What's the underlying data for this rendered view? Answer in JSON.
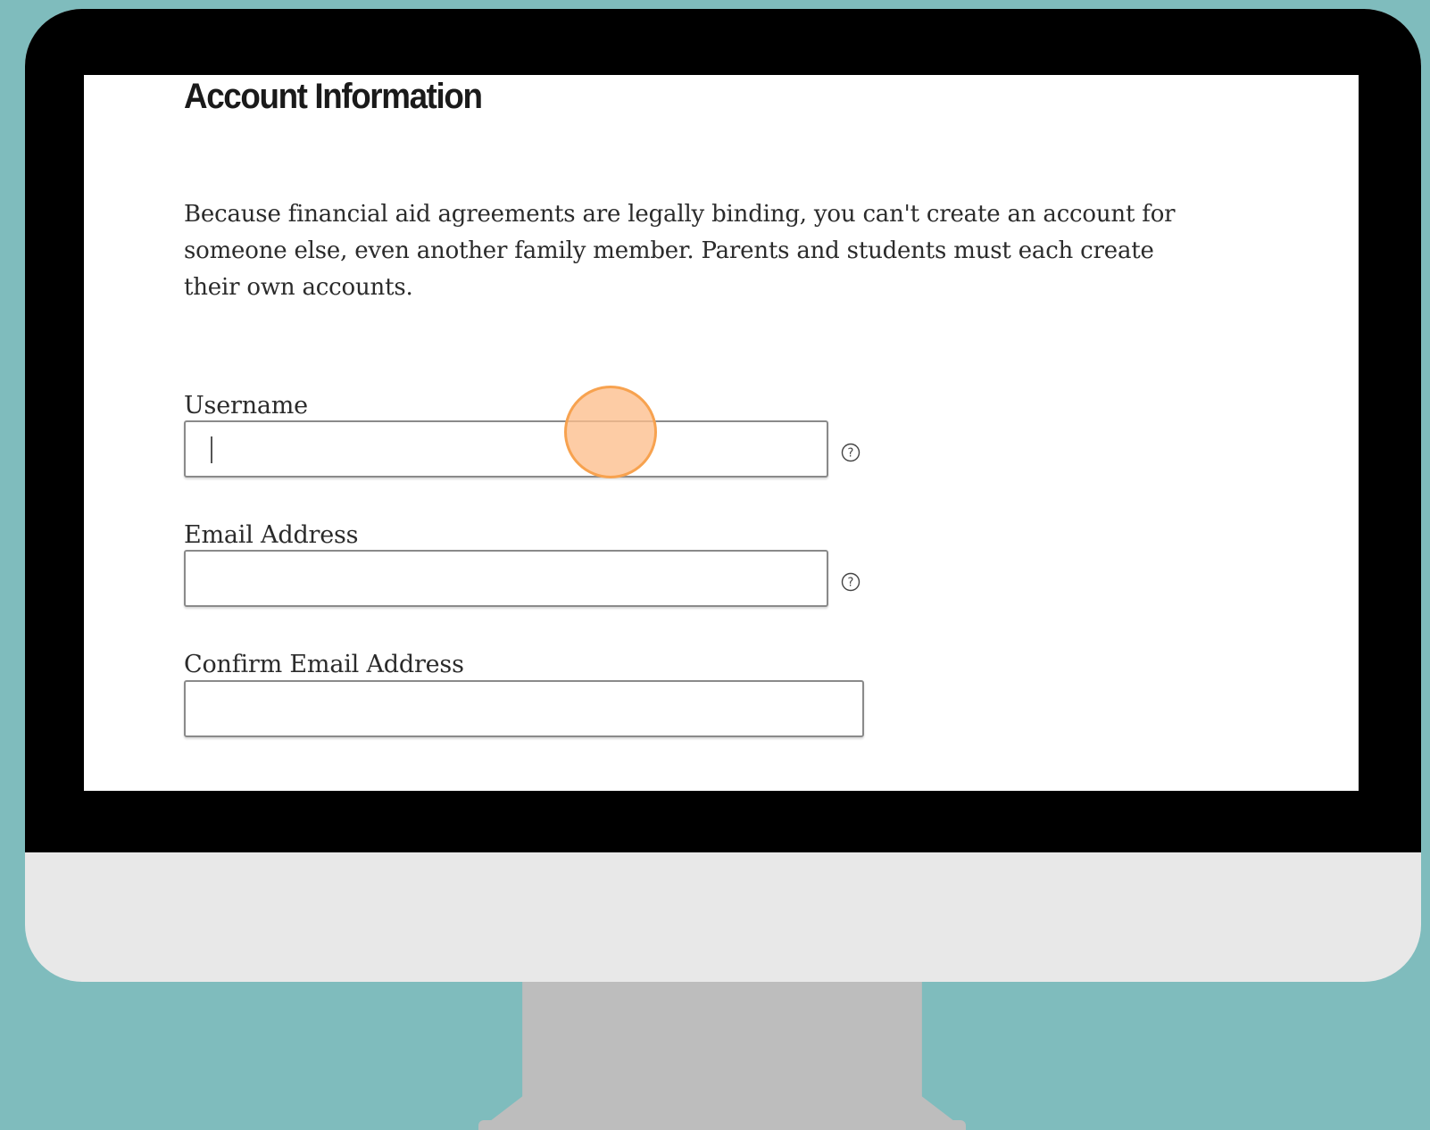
{
  "page": {
    "title": "Account Information",
    "intro": "Because financial aid agreements are legally binding, you can't create an account for someone else, even another family member. Parents and students must each create their own accounts."
  },
  "form": {
    "username": {
      "label": "Username",
      "value": "",
      "has_help": true
    },
    "email": {
      "label": "Email Address",
      "value": "",
      "has_help": true
    },
    "confirm_email": {
      "label": "Confirm Email Address",
      "value": ""
    }
  },
  "icons": {
    "help": "question-circle-icon"
  },
  "colors": {
    "background": "#7fbcbd",
    "bezel": "#000000",
    "chin": "#e8e8e8",
    "stand": "#bdbdbd",
    "click_marker": "#f7a24f"
  }
}
